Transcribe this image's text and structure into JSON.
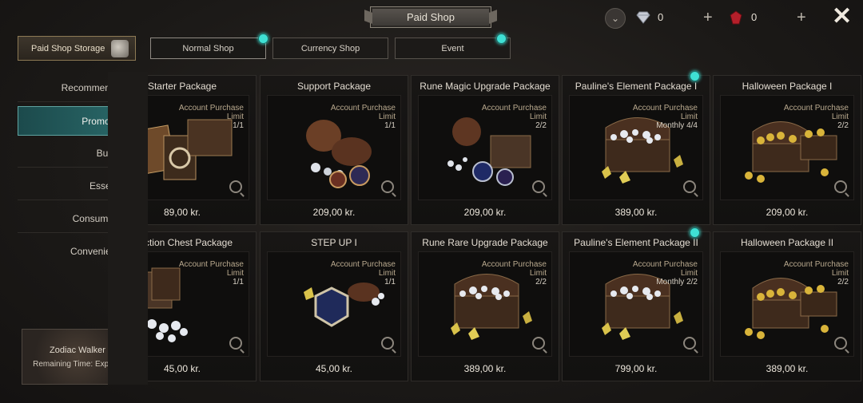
{
  "header": {
    "title": "Paid Shop"
  },
  "top_bar": {
    "currency_a": {
      "icon": "diamond-icon",
      "value": "0"
    },
    "currency_b": {
      "icon": "red-gem-icon",
      "value": "0"
    }
  },
  "storage_label": "Paid Shop Storage",
  "tabs": [
    {
      "label": "Normal Shop",
      "active": true,
      "badge": true
    },
    {
      "label": "Currency Shop",
      "active": false,
      "badge": false
    },
    {
      "label": "Event",
      "active": false,
      "badge": true
    }
  ],
  "sidebar": [
    {
      "label": "Recommended",
      "active": false,
      "badge": false
    },
    {
      "label": "Promotion",
      "active": true,
      "badge": true
    },
    {
      "label": "Bundle",
      "active": false,
      "badge": true
    },
    {
      "label": "Essence",
      "active": false,
      "badge": false
    },
    {
      "label": "Consumable",
      "active": false,
      "badge": false
    },
    {
      "label": "Convenience",
      "active": false,
      "badge": false
    }
  ],
  "zodiac": {
    "name": "Zodiac Walker",
    "time": "Remaining Time: Expired"
  },
  "products": [
    {
      "name": "Starter Package",
      "limit_type": "Account Purchase",
      "limit_word": "Limit",
      "limit_count": "1/1",
      "price": "89,00 kr.",
      "art": "cards",
      "badge": false
    },
    {
      "name": "Support Package",
      "limit_type": "Account Purchase",
      "limit_word": "Limit",
      "limit_count": "1/1",
      "price": "209,00 kr.",
      "art": "bags",
      "badge": false
    },
    {
      "name": "Rune Magic Upgrade Package",
      "limit_type": "Account Purchase",
      "limit_word": "Limit",
      "limit_count": "2/2",
      "price": "209,00 kr.",
      "art": "rune",
      "badge": false
    },
    {
      "name": "Pauline's Element Package I",
      "limit_type": "Account Purchase",
      "limit_word": "Limit",
      "limit_count": "Monthly 4/4",
      "price": "389,00 kr.",
      "art": "chest-silver",
      "badge": true
    },
    {
      "name": "Halloween Package I",
      "limit_type": "Account Purchase",
      "limit_word": "Limit",
      "limit_count": "2/2",
      "price": "209,00 kr.",
      "art": "chest-gold",
      "badge": false
    },
    {
      "name": "election Chest Package",
      "limit_type": "Account Purchase",
      "limit_word": "Limit",
      "limit_count": "1/1",
      "price": "45,00 kr.",
      "art": "boxes",
      "badge": false
    },
    {
      "name": "STEP UP I",
      "limit_type": "Account Purchase",
      "limit_word": "Limit",
      "limit_count": "1/1",
      "price": "45,00 kr.",
      "art": "hex",
      "badge": false
    },
    {
      "name": "Rune Rare Upgrade Package",
      "limit_type": "Account Purchase",
      "limit_word": "Limit",
      "limit_count": "2/2",
      "price": "389,00 kr.",
      "art": "chest-silver",
      "badge": false
    },
    {
      "name": "Pauline's Element Package II",
      "limit_type": "Account Purchase",
      "limit_word": "Limit",
      "limit_count": "Monthly 2/2",
      "price": "799,00 kr.",
      "art": "chest-silver",
      "badge": true
    },
    {
      "name": "Halloween Package II",
      "limit_type": "Account Purchase",
      "limit_word": "Limit",
      "limit_count": "2/2",
      "price": "389,00 kr.",
      "art": "chest-gold",
      "badge": false
    }
  ],
  "colors": {
    "accent_teal": "#3fe0d4",
    "active_side": "#2a6a6a",
    "limit_text": "#b9a98e"
  }
}
